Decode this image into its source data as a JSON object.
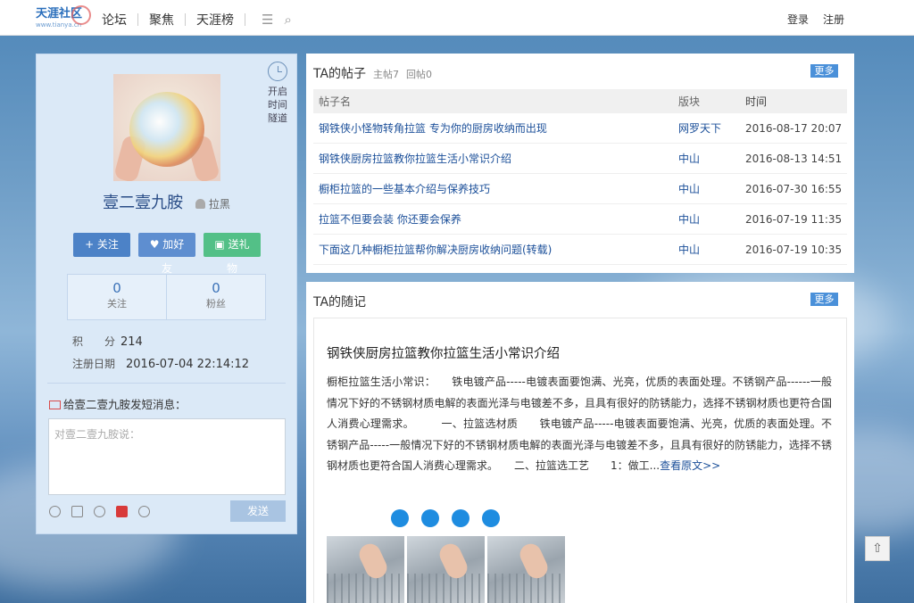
{
  "header": {
    "logo_text": "天涯社区",
    "logo_sub": "www.tianya.cn",
    "nav": [
      "论坛",
      "聚焦",
      "天涯榜"
    ],
    "login": "登录",
    "register": "注册"
  },
  "profile": {
    "timeline_label": [
      "开启",
      "时间",
      "隧道"
    ],
    "username": "壹二壹九胺",
    "block_label": "拉黑",
    "follow_btn": "+ 关注",
    "friend_btn": "加好友",
    "gift_btn": "送礼物",
    "following_count": "0",
    "following_label": "关注",
    "fans_count": "0",
    "fans_label": "粉丝",
    "points_label": "积　　分",
    "points_value": "214",
    "reg_label": "注册日期",
    "reg_value": "2016-07-04 22:14:12",
    "message_title": "给壹二壹九胺发短消息：",
    "message_placeholder": "对壹二壹九胺说：",
    "send_btn": "发送"
  },
  "posts": {
    "title": "TA的帖子",
    "main_count": "主帖7",
    "reply_count": "回帖0",
    "more": "更多",
    "headers": [
      "帖子名",
      "版块",
      "时间"
    ],
    "rows": [
      {
        "title": "钢铁侠小怪物转角拉篮 专为你的厨房收纳而出现",
        "board": "网罗天下",
        "time": "2016-08-17 20:07"
      },
      {
        "title": "钢铁侠厨房拉篮教你拉篮生活小常识介绍",
        "board": "中山",
        "time": "2016-08-13 14:51"
      },
      {
        "title": "橱柜拉篮的一些基本介绍与保养技巧",
        "board": "中山",
        "time": "2016-07-30 16:55"
      },
      {
        "title": "拉篮不但要会装 你还要会保养",
        "board": "中山",
        "time": "2016-07-19 11:35"
      },
      {
        "title": "下面这几种橱柜拉篮帮你解决厨房收纳问题(转载)",
        "board": "中山",
        "time": "2016-07-19 10:35"
      }
    ]
  },
  "notes": {
    "title": "TA的随记",
    "more": "更多",
    "note_title": "钢铁侠厨房拉篮教你拉篮生活小常识介绍",
    "note_text": "橱柜拉篮生活小常识：　　铁电镀产品-----电镀表面要饱满、光亮，优质的表面处理。不锈钢产品------一般情况下好的不锈钢材质电解的表面光泽与电镀差不多，且具有很好的防锈能力，选择不锈钢材质也更符合国人消费心理需求。　　　一、拉篮选材质　　铁电镀产品-----电镀表面要饱满、光亮，优质的表面处理。不锈钢产品-----一般情况下好的不锈钢材质电解的表面光泽与电镀差不多，且具有很好的防锈能力，选择不锈钢材质也更符合国人消费心理需求。　　二、拉篮选工艺　　1：做工...",
    "read_more": "查看原文>>"
  }
}
